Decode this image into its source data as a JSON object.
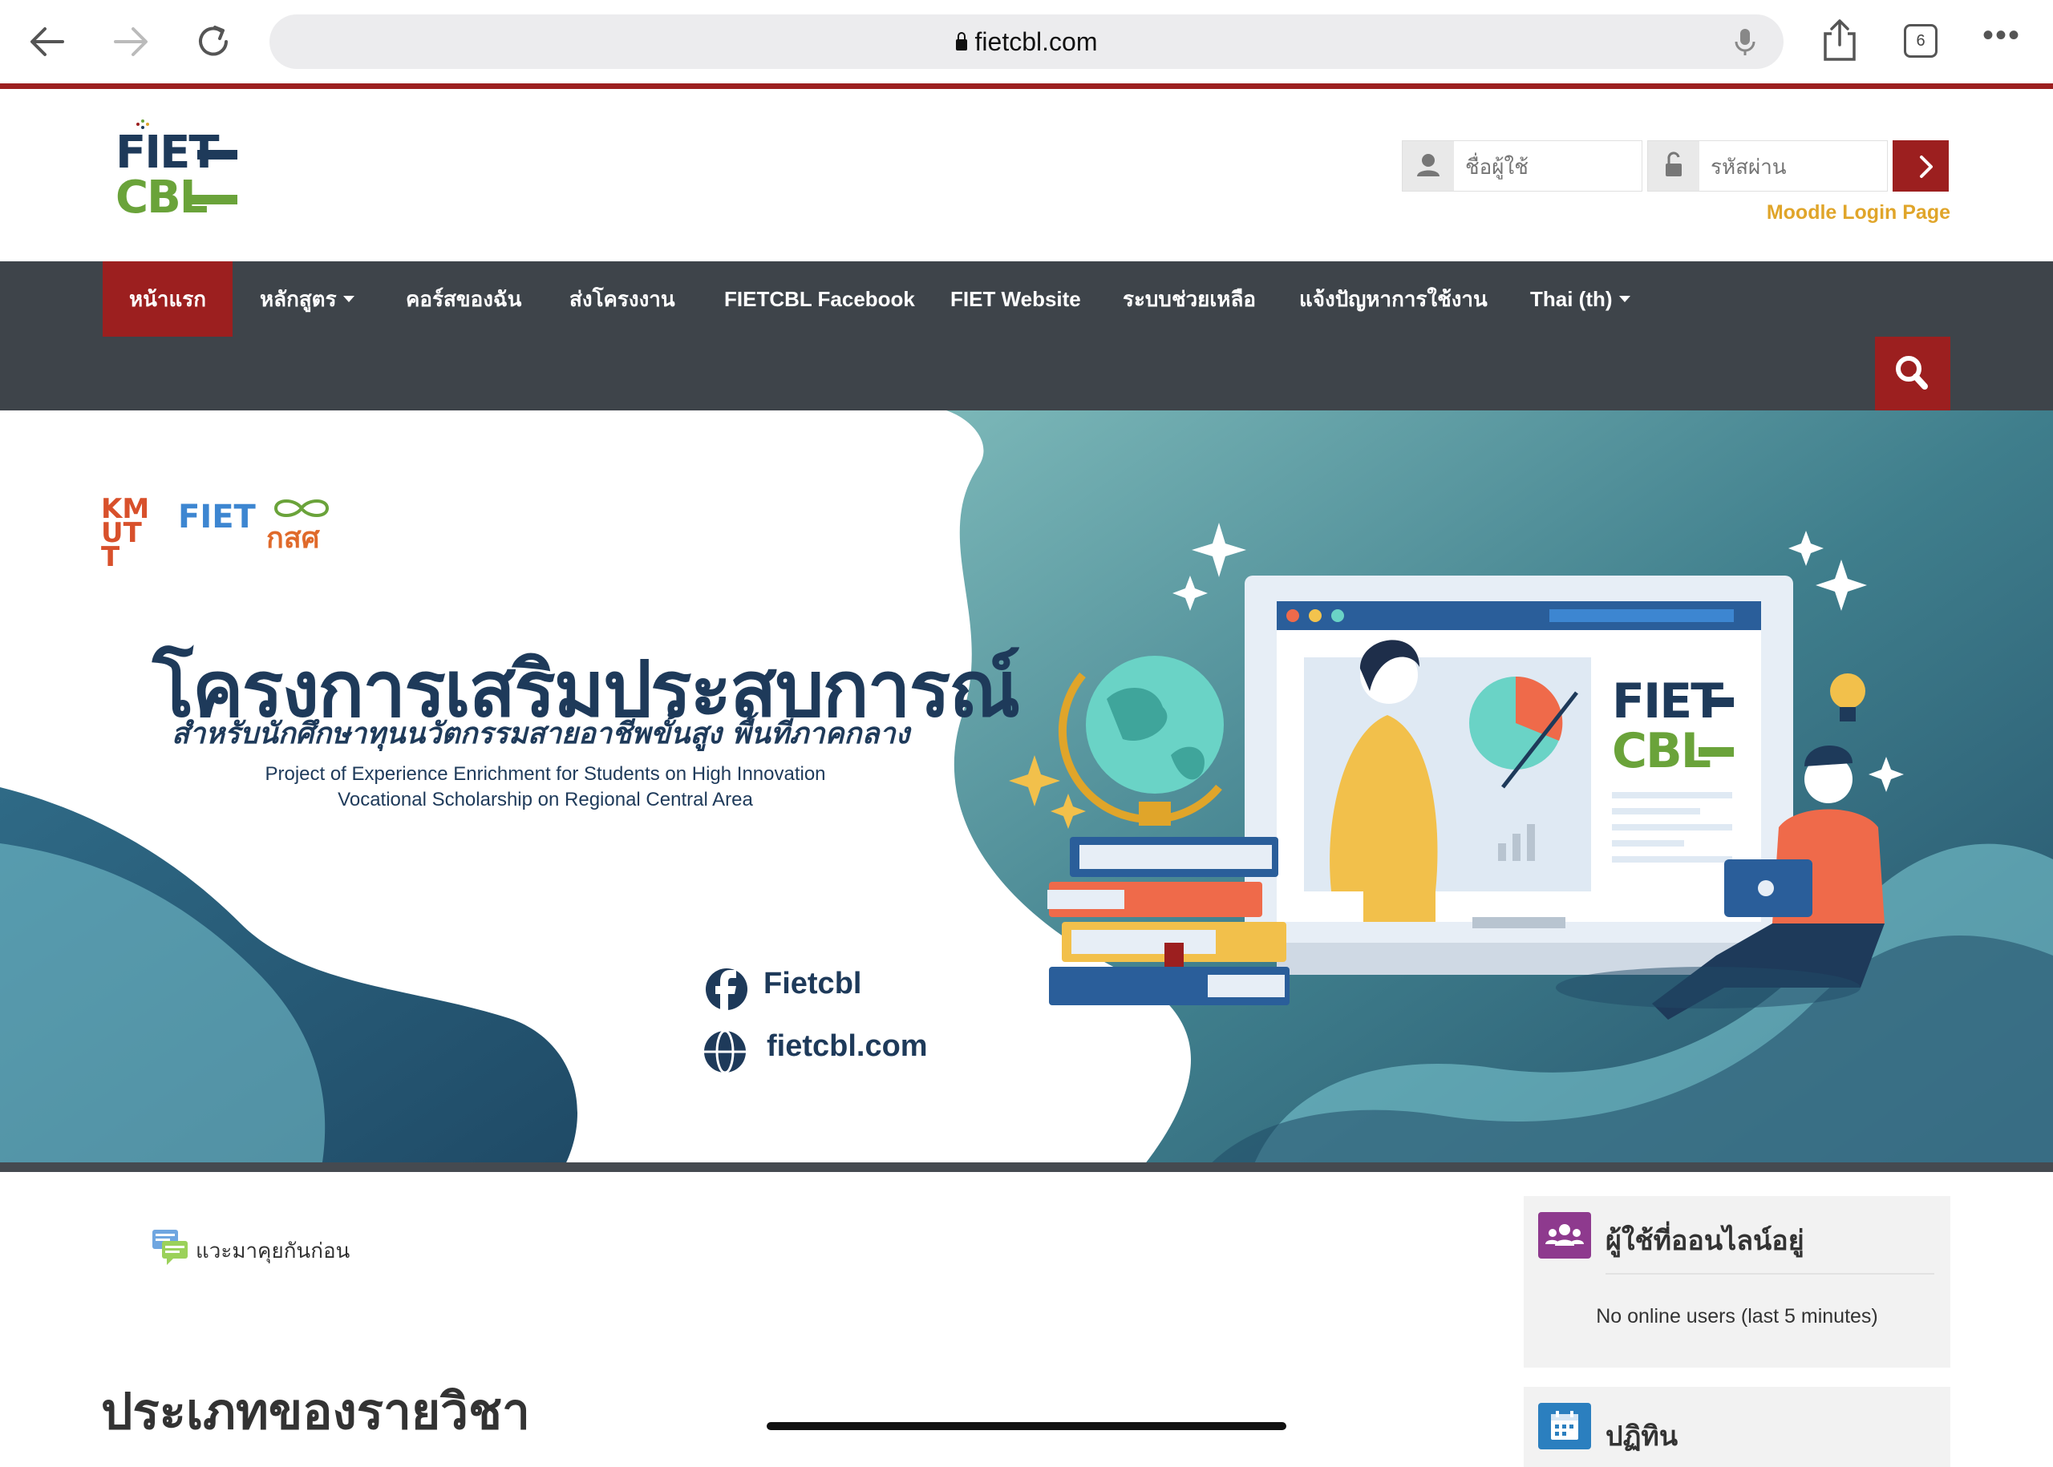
{
  "browser": {
    "url": "fietcbl.com",
    "tab_count": "6",
    "more_label": "•••"
  },
  "header": {
    "logo_line1": "FIET",
    "logo_line2": "CBL",
    "username_placeholder": "ชื่อผู้ใช้",
    "password_placeholder": "รหัสผ่าน",
    "moodle_login_label": "Moodle Login Page"
  },
  "nav": {
    "items": [
      {
        "label": "หน้าแรก"
      },
      {
        "label": "หลักสูตร"
      },
      {
        "label": "คอร์สของฉัน"
      },
      {
        "label": "ส่งโครงงาน"
      },
      {
        "label": "FIETCBL Facebook"
      },
      {
        "label": "FIET Website"
      },
      {
        "label": "ระบบช่วยเหลือ"
      },
      {
        "label": "แจ้งปัญหาการใช้งาน"
      },
      {
        "label": "Thai (th)"
      }
    ]
  },
  "banner": {
    "title": "โครงการเสริมประสบการณ์",
    "subtitle": "สำหรับนักศึกษาทุนนวัตกรรมสายอาชีพขั้นสูง พื้นที่ภาคกลาง",
    "english_line1": "Project of Experience Enrichment for Students on High Innovation",
    "english_line2": "Vocational Scholarship on Regional Central Area",
    "facebook_text": "Fietcbl",
    "website_text": "fietcbl.com",
    "logo_kmutt": "KMUTT",
    "logo_fiet": "FIET",
    "logo_kosor": "กสศ",
    "board_logo_line1": "FIET",
    "board_logo_line2": "CBL"
  },
  "content": {
    "chat_link": "แวะมาคุยกันก่อน",
    "category_heading": "ประเภทของรายวิชา"
  },
  "sidebar": {
    "online_users_title": "ผู้ใช้ที่ออนไลน์อยู่",
    "online_users_empty": "No online users (last 5 minutes)",
    "calendar_title": "ปฏิทิน"
  },
  "colors": {
    "brand_red": "#9c1f1f",
    "nav_bg": "#3e444a",
    "link_gold": "#e0a52a",
    "logo_navy": "#1e3a5a",
    "logo_green": "#6aa33a"
  }
}
